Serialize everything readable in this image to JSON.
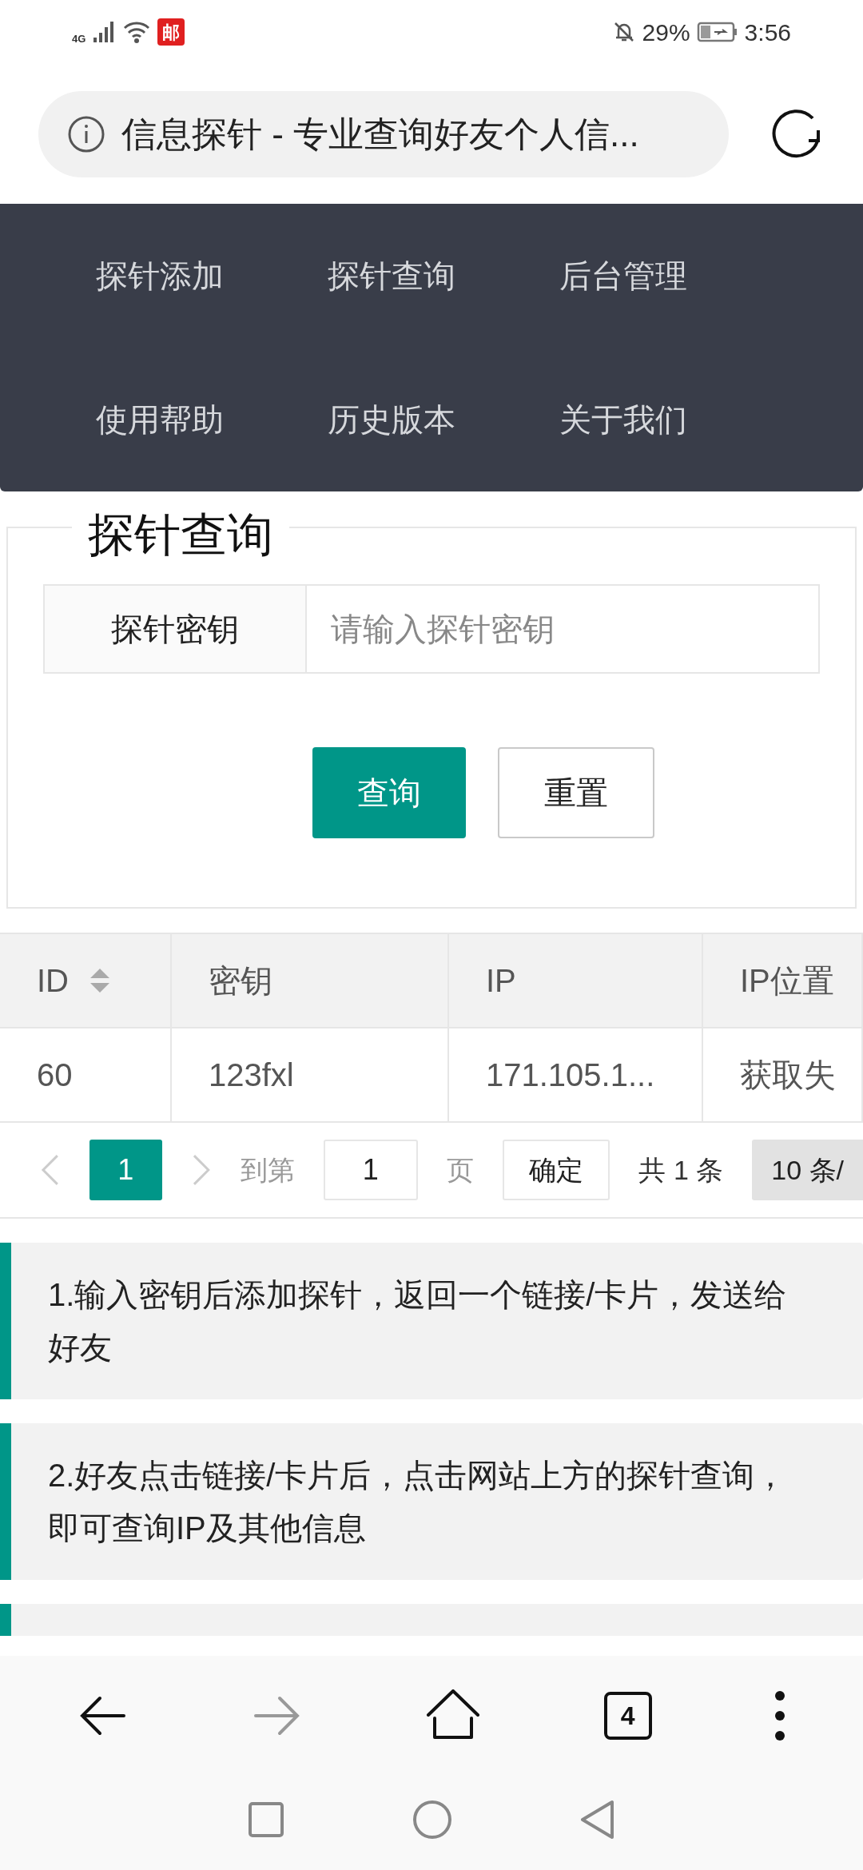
{
  "status_bar": {
    "network": "4G",
    "app_badge": "邮",
    "battery": "29%",
    "time": "3:56"
  },
  "address_bar": {
    "title": "信息探针 - 专业查询好友个人信..."
  },
  "nav": {
    "items": [
      {
        "label": "探针添加"
      },
      {
        "label": "探针查询"
      },
      {
        "label": "后台管理"
      },
      {
        "label": "使用帮助"
      },
      {
        "label": "历史版本"
      },
      {
        "label": "关于我们"
      }
    ]
  },
  "query_form": {
    "legend": "探针查询",
    "field_label": "探针密钥",
    "placeholder": "请输入探针密钥",
    "buttons": [
      {
        "label": "查询",
        "kind": "primary"
      },
      {
        "label": "重置",
        "kind": "secondary"
      }
    ]
  },
  "table": {
    "columns": [
      "ID",
      "密钥",
      "IP",
      "IP位置"
    ],
    "rows": [
      [
        "60",
        "123fxl",
        "171.105.1...",
        "获取失"
      ]
    ]
  },
  "pagination": {
    "pages": [
      {
        "label": "1",
        "selected": true
      }
    ],
    "goto_label": "到第",
    "goto_value": "1",
    "page_unit": "页",
    "confirm": "确定",
    "total": "共 1 条",
    "page_size": "10 条/"
  },
  "notes": [
    "1.输入密钥后添加探针，返回一个链接/卡片，发送给好友",
    "2.好友点击链接/卡片后，点击网站上方的探针查询，即可查询IP及其他信息"
  ],
  "browser_toolbar": {
    "tab_count": "4"
  }
}
